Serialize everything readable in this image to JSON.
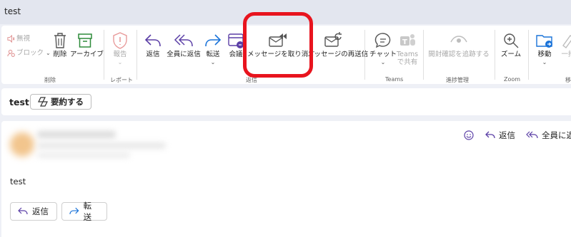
{
  "window": {
    "title": "test"
  },
  "ribbon": {
    "mute": "無視",
    "block": "ブロック",
    "delete": "削除",
    "archive": "アーカイブ",
    "report": "報告",
    "reply": "返信",
    "reply_all": "全員に返信",
    "forward": "転送",
    "meeting": "会議",
    "recall": "メッセージを取り消す",
    "resend": "メッセージの再送信",
    "chat": "チャット",
    "teams_share_1": "Teams",
    "teams_share_2": "で共有",
    "track_read": "開封確認を追跡する",
    "zoom": "ズーム",
    "move": "移動",
    "partial": "一括",
    "groups": {
      "delete": "削除",
      "report": "レポート",
      "respond": "返信",
      "teams": "Teams",
      "tracking": "進捗管理",
      "zoom": "Zoom",
      "move": "移"
    },
    "accent_color": "#5b3fa6",
    "reply_color": "#5b3fa6",
    "forward_color": "#1a73d9"
  },
  "subject_bar": {
    "subject": "test",
    "summarize": "要約する"
  },
  "message": {
    "body": "test",
    "reply_action": "返信",
    "reply_all_action": "全員に返",
    "reply_button": "返信",
    "forward_button": "転送"
  }
}
